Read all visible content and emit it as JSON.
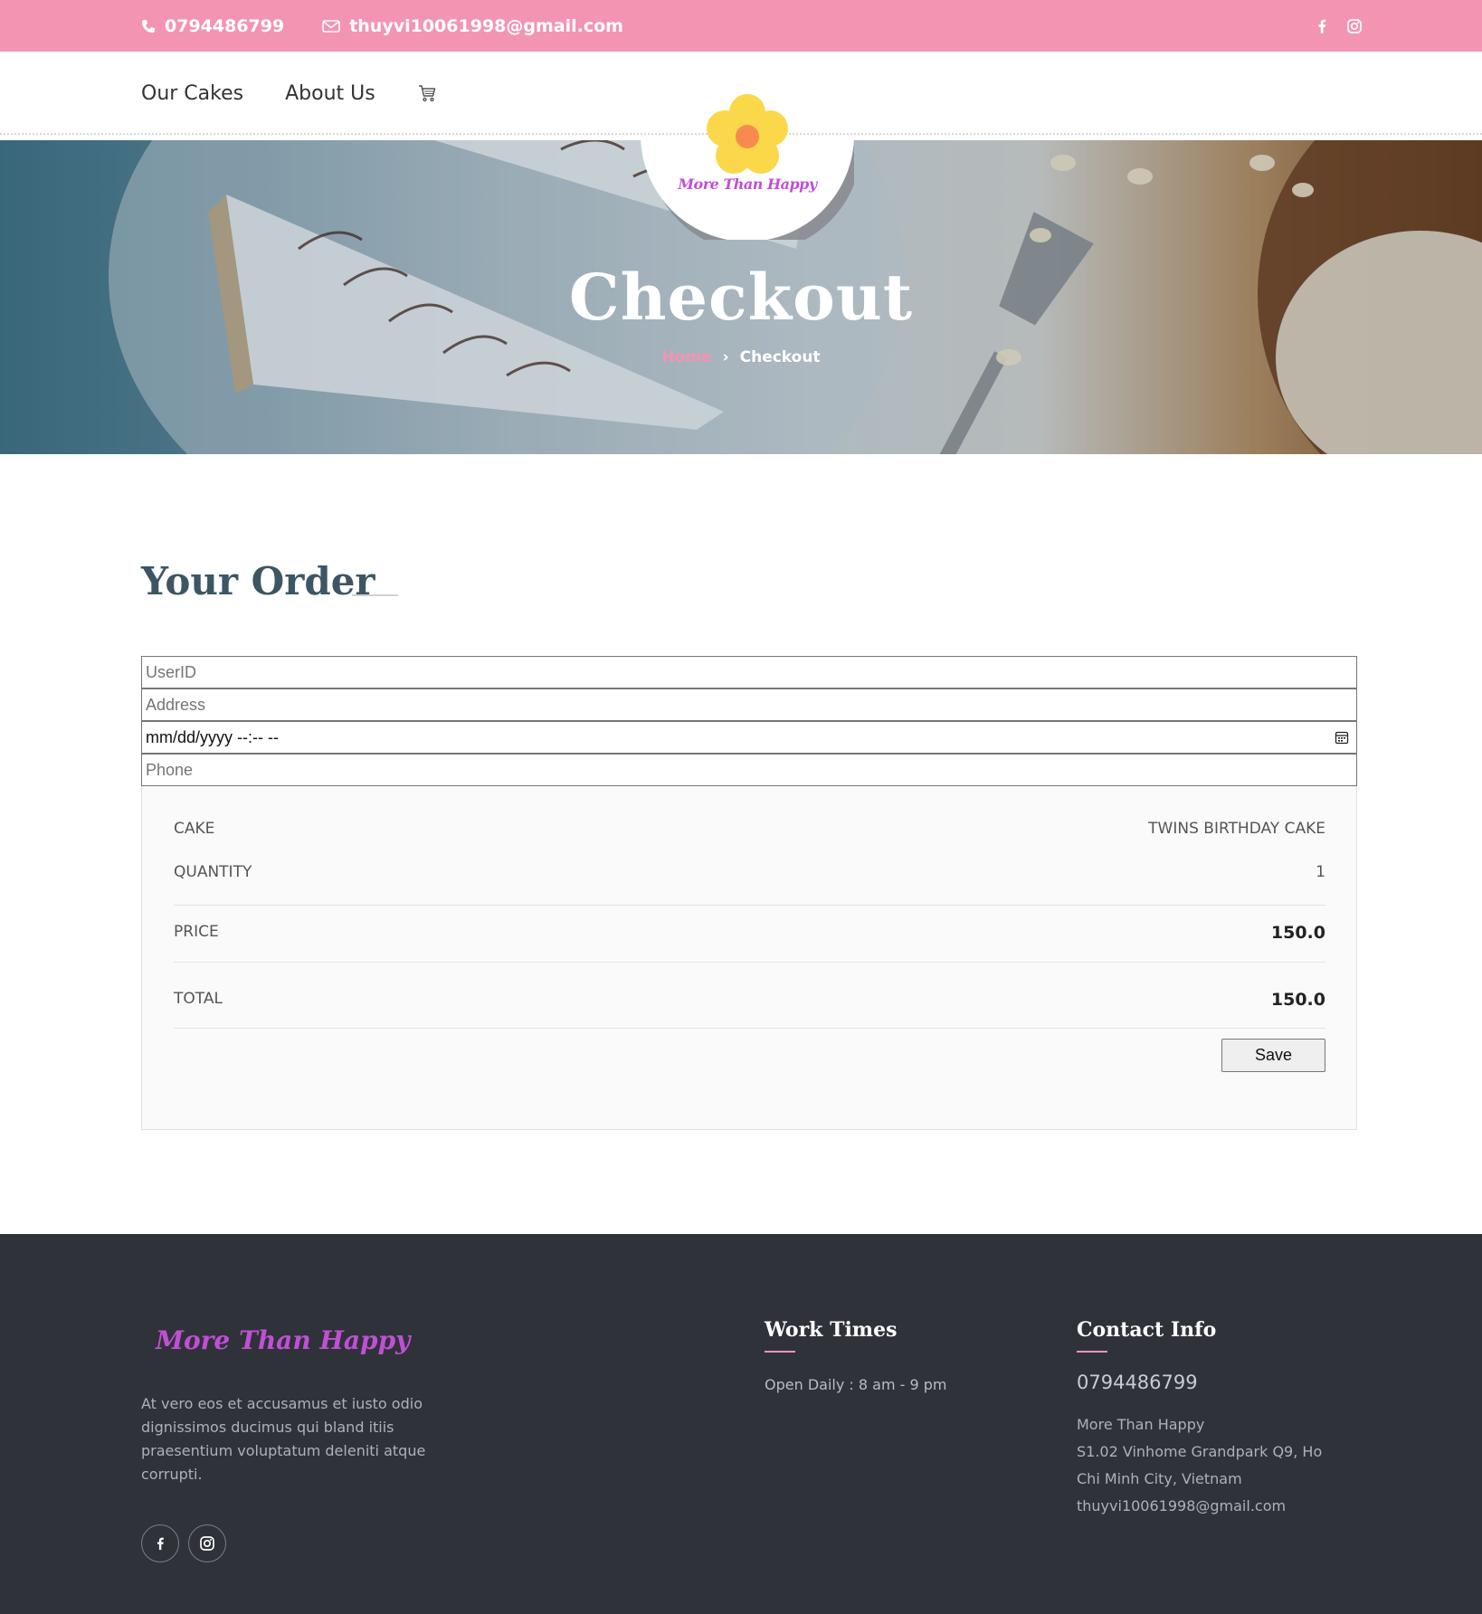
{
  "topbar": {
    "phone": "0794486799",
    "email": "thuyvi10061998@gmail.com",
    "social_icons": [
      "facebook-icon",
      "instagram-icon"
    ]
  },
  "nav": {
    "items": [
      {
        "label": "Our Cakes"
      },
      {
        "label": "About Us"
      }
    ],
    "cart_icon": "cart-icon"
  },
  "logo": {
    "text": "More Than Happy",
    "icon": "flower-icon"
  },
  "hero": {
    "title": "Checkout",
    "breadcrumb": {
      "home": "Home",
      "separator": "›",
      "current": "Checkout"
    }
  },
  "order": {
    "heading": "Your Order",
    "fields": {
      "userid_placeholder": "UserID",
      "address_placeholder": "Address",
      "datetime_value": "mm/dd/yyyy --:-- --",
      "phone_placeholder": "Phone"
    },
    "summary": {
      "cake_label": "CAKE",
      "cake_value": "TWINS BIRTHDAY CAKE",
      "quantity_label": "QUANTITY",
      "quantity_value": "1",
      "price_label": "PRICE",
      "price_value": "150.0",
      "total_label": "TOTAL",
      "total_value": "150.0"
    },
    "save_label": "Save"
  },
  "footer": {
    "brand": "More Than Happy",
    "about": "At vero eos et accusamus et iusto odio dignissimos ducimus qui bland itiis praesentium voluptatum deleniti atque corrupti.",
    "work_times": {
      "heading": "Work Times",
      "text": "Open Daily : 8 am - 9 pm"
    },
    "contact": {
      "heading": "Contact Info",
      "phone": "0794486799",
      "name": "More Than Happy",
      "address": "S1.02 Vinhome Grandpark Q9, Ho Chi Minh City, Vietnam",
      "email": "thuyvi10061998@gmail.com"
    }
  },
  "colors": {
    "accent_pink": "#f394b3",
    "brand_purple": "#c04fd6",
    "heading_slate": "#3d5664",
    "footer_bg": "#2f3239"
  }
}
